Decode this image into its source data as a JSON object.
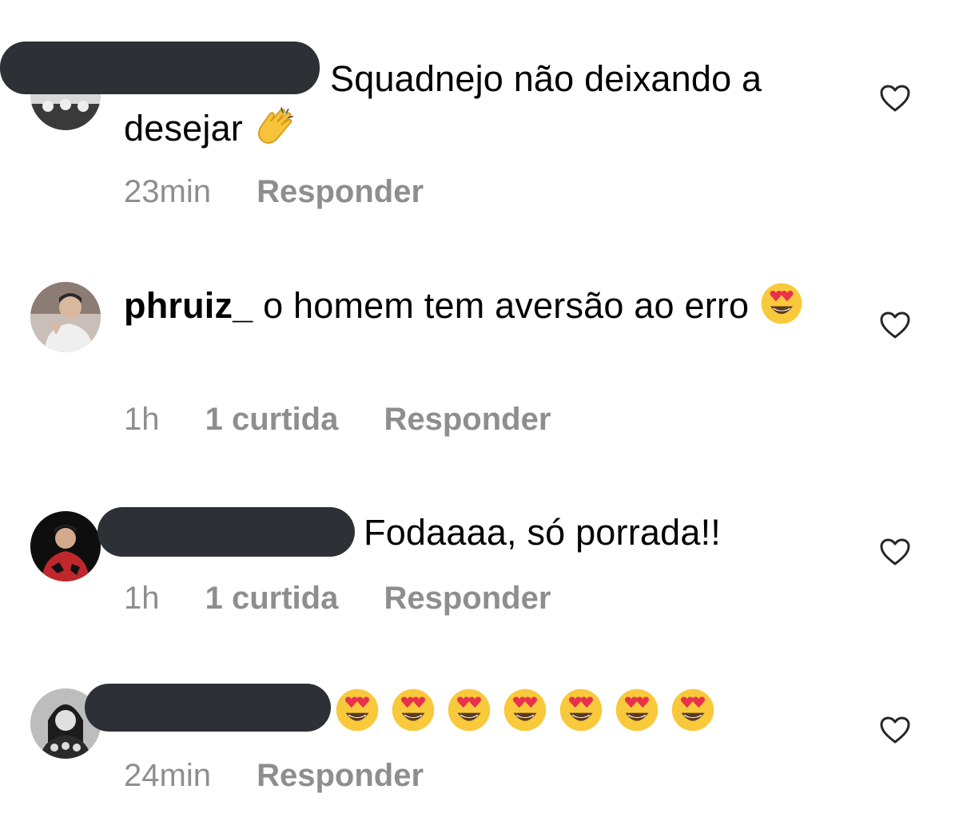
{
  "comments": [
    {
      "text": "Squadnejo não deixando a desejar",
      "emoji": "clapping-hands",
      "time": "23min",
      "reply": "Responder"
    },
    {
      "username": "phruiz_",
      "text": "o homem tem aversão ao erro",
      "emoji": "smiling-face-with-heart-eyes",
      "time": "1h",
      "likes": "1 curtida",
      "reply": "Responder"
    },
    {
      "text": "Fodaaaa, só porrada!!",
      "time": "1h",
      "likes": "1 curtida",
      "reply": "Responder"
    },
    {
      "emoji": "smiling-face-with-heart-eyes",
      "emoji_count": 7,
      "time": "24min",
      "reply": "Responder"
    }
  ],
  "colors": {
    "text": "#000000",
    "meta": "#8e8e8e",
    "redaction": "#2d3035",
    "heart_outline": "#262626"
  },
  "icons": {
    "like": "heart-outline-icon"
  }
}
